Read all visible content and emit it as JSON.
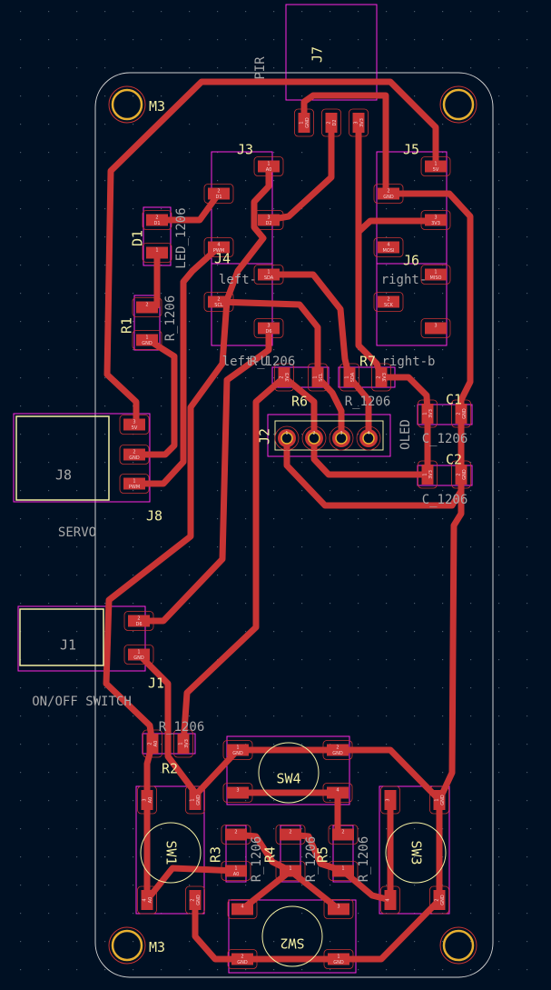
{
  "view": {
    "colors": {
      "background": "#001023",
      "copper": "#c83434",
      "courtyard": "#ff26e2",
      "silkscreen_ref": "#f2eda1",
      "silkscreen_value": "#a8a8a8",
      "board_edge": "#d0d0d0",
      "mounting_hole": "#e8b030"
    }
  },
  "mounting_holes": {
    "label": "M3"
  },
  "components": {
    "J7": {
      "ref": "J7",
      "value": "PIR",
      "pads": [
        {
          "n": "1",
          "net": "GND"
        },
        {
          "n": "2",
          "net": "D2"
        },
        {
          "n": "3",
          "net": "3V3"
        }
      ]
    },
    "J3": {
      "ref": "J3",
      "value": "left-",
      "pads": [
        {
          "n": "1",
          "net": "A0"
        },
        {
          "n": "2",
          "net": "D1"
        },
        {
          "n": "3",
          "net": "D2"
        },
        {
          "n": "4",
          "net": "PWM"
        }
      ]
    },
    "J4": {
      "ref": "J4",
      "value": "left-U",
      "pads": [
        {
          "n": "1",
          "net": "SDA"
        },
        {
          "n": "2",
          "net": "SCL"
        },
        {
          "n": "3",
          "net": "D6"
        }
      ]
    },
    "J5": {
      "ref": "J5",
      "value": "right-",
      "pads": [
        {
          "n": "1",
          "net": "5V"
        },
        {
          "n": "2",
          "net": "GND"
        },
        {
          "n": "3",
          "net": "3V3"
        },
        {
          "n": "4",
          "net": "MOSI"
        }
      ]
    },
    "J6": {
      "ref": "J6",
      "value": "right-b",
      "pads": [
        {
          "n": "1",
          "net": "MISO"
        },
        {
          "n": "2",
          "net": "SCK"
        },
        {
          "n": "3",
          "net": ""
        }
      ]
    },
    "D1": {
      "ref": "D1",
      "value": "LED_1206",
      "pads": [
        {
          "n": "2",
          "net": "D1"
        },
        {
          "n": "1",
          "net": ""
        }
      ]
    },
    "R1": {
      "ref": "R1",
      "value": "R_1206",
      "pads": [
        {
          "n": "2",
          "net": ""
        },
        {
          "n": "1",
          "net": "GND"
        }
      ]
    },
    "J8": {
      "ref": "J8",
      "value": "SERVO",
      "pads": [
        {
          "n": "3",
          "net": "5V"
        },
        {
          "n": "2",
          "net": "GND"
        },
        {
          "n": "1",
          "net": "PWM"
        }
      ]
    },
    "R6": {
      "ref": "R6",
      "value": "R_1206",
      "pads": [
        {
          "n": "2",
          "net": "3V3"
        },
        {
          "n": "1",
          "net": "SCL"
        }
      ]
    },
    "R7": {
      "ref": "R7",
      "value": "R_1206",
      "pads": [
        {
          "n": "1",
          "net": "SDA"
        },
        {
          "n": "2",
          "net": "3V3"
        }
      ]
    },
    "J2": {
      "ref": "J2",
      "value": "OLED",
      "pads": [
        {
          "n": "1",
          "net": ""
        },
        {
          "n": "2",
          "net": ""
        },
        {
          "n": "3",
          "net": ""
        },
        {
          "n": "4",
          "net": ""
        }
      ]
    },
    "C1": {
      "ref": "C1",
      "value": "C_1206",
      "pads": [
        {
          "n": "1",
          "net": "3V3"
        },
        {
          "n": "2",
          "net": "GND"
        }
      ]
    },
    "C2": {
      "ref": "C2",
      "value": "C_1206",
      "pads": [
        {
          "n": "1",
          "net": "3V3"
        },
        {
          "n": "2",
          "net": "GND"
        }
      ]
    },
    "J1": {
      "ref": "J1",
      "value": "ON/OFF SWITCH",
      "pads": [
        {
          "n": "2",
          "net": "D6"
        },
        {
          "n": "1",
          "net": "GND"
        }
      ]
    },
    "R2": {
      "ref": "R2",
      "value": "R_1206",
      "pads": [
        {
          "n": "2",
          "net": "A0"
        },
        {
          "n": "1",
          "net": "3V3"
        }
      ]
    },
    "SW4": {
      "ref": "SW4",
      "value": "",
      "pads": [
        {
          "n": "1",
          "net": "GND"
        },
        {
          "n": "2",
          "net": "GND"
        },
        {
          "n": "3",
          "net": ""
        },
        {
          "n": "4",
          "net": ""
        }
      ]
    },
    "SW1": {
      "ref": "SW1",
      "value": "",
      "pads": [
        {
          "n": "3",
          "net": "A0"
        },
        {
          "n": "1",
          "net": "GND"
        },
        {
          "n": "4",
          "net": "A0"
        },
        {
          "n": "2",
          "net": "GND"
        }
      ]
    },
    "SW3": {
      "ref": "SW3",
      "value": "",
      "pads": [
        {
          "n": "3",
          "net": ""
        },
        {
          "n": "1",
          "net": "GND"
        },
        {
          "n": "4",
          "net": ""
        },
        {
          "n": "2",
          "net": "GND"
        }
      ]
    },
    "SW2": {
      "ref": "SW2",
      "value": "",
      "pads": [
        {
          "n": "4",
          "net": ""
        },
        {
          "n": "3",
          "net": ""
        },
        {
          "n": "2",
          "net": "GND"
        },
        {
          "n": "1",
          "net": "GND"
        }
      ]
    },
    "R3": {
      "ref": "R3",
      "value": "R_1206",
      "pads": [
        {
          "n": "2",
          "net": ""
        },
        {
          "n": "1",
          "net": "A0"
        }
      ]
    },
    "R4": {
      "ref": "R4",
      "value": "R_1206",
      "pads": [
        {
          "n": "2",
          "net": ""
        },
        {
          "n": "1",
          "net": ""
        }
      ]
    },
    "R5": {
      "ref": "R5",
      "value": "R_1206",
      "pads": [
        {
          "n": "2",
          "net": ""
        },
        {
          "n": "1",
          "net": ""
        }
      ]
    }
  }
}
